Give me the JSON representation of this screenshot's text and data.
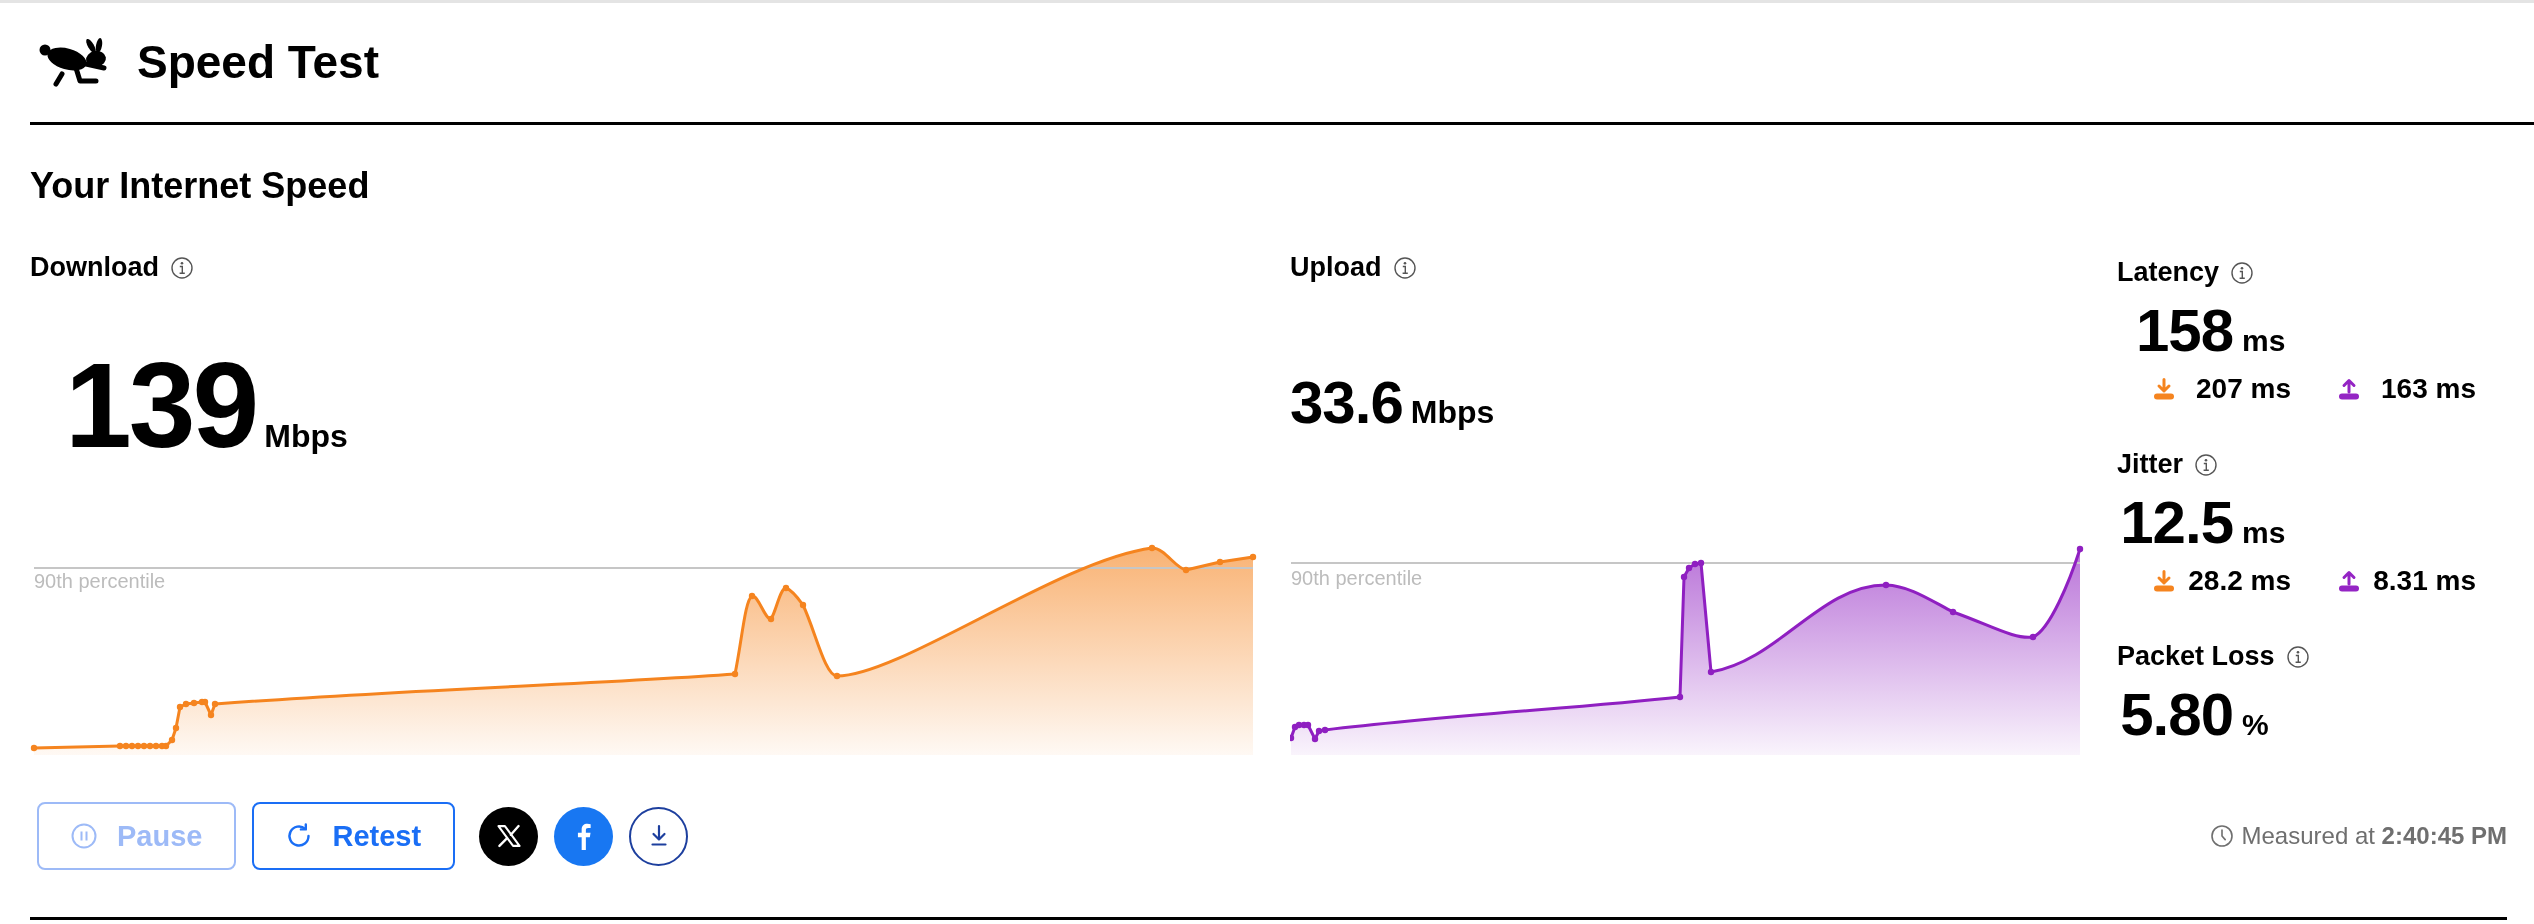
{
  "header": {
    "title": "Speed Test"
  },
  "section_title": "Your Internet Speed",
  "download": {
    "label": "Download",
    "value": "139",
    "unit": "Mbps",
    "percentile_label": "90th percentile"
  },
  "upload": {
    "label": "Upload",
    "value": "33.6",
    "unit": "Mbps",
    "percentile_label": "90th percentile"
  },
  "stats": [
    {
      "label": "Latency",
      "value": "158",
      "unit": "ms",
      "download": "207 ms",
      "upload": "163 ms"
    },
    {
      "label": "Jitter",
      "value": "12.5",
      "unit": "ms",
      "download": "28.2 ms",
      "upload": "8.31 ms"
    },
    {
      "label": "Packet Loss",
      "value": "5.80",
      "unit": "%"
    }
  ],
  "buttons": [
    {
      "kind": "pause",
      "label": "Pause",
      "disabled": true
    },
    {
      "kind": "retest",
      "label": "Retest",
      "disabled": false
    }
  ],
  "measured": "Measured at **2:40:45 PM**"
}
